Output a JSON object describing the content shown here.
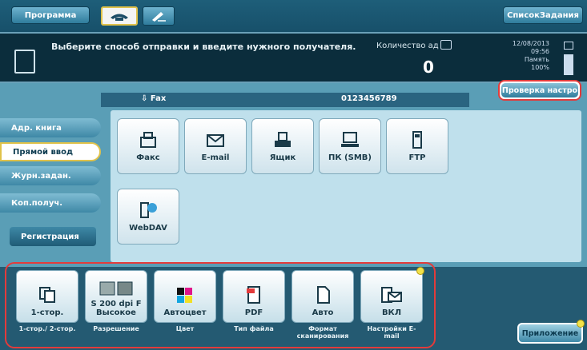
{
  "topbar": {
    "program_label": "Программа",
    "job_list_label": "СписокЗадания"
  },
  "message": {
    "text": "Выберите способ отправки и введите нужного получателя.",
    "count_label": "Количество ад",
    "count_value": "0",
    "date_lines": [
      "12/08/2013",
      "09:56",
      "Память",
      "100%"
    ]
  },
  "destination": {
    "type_label": "Fax",
    "number": "0123456789"
  },
  "check_settings_label": "Проверка настро",
  "left_nav": [
    {
      "label": "Адр. книга"
    },
    {
      "label": "Прямой ввод"
    },
    {
      "label": "Журн.задан."
    },
    {
      "label": "Коп.получ."
    },
    {
      "label": "Регистрация"
    }
  ],
  "dest_types": [
    {
      "label": "Факс",
      "icon": "fax-icon"
    },
    {
      "label": "E-mail",
      "icon": "email-icon"
    },
    {
      "label": "Ящик",
      "icon": "box-icon"
    },
    {
      "label": "ПК (SMB)",
      "icon": "pc-icon"
    },
    {
      "label": "FTP",
      "icon": "ftp-icon"
    },
    {
      "label": "WebDAV",
      "icon": "webdav-icon"
    }
  ],
  "settings": [
    {
      "value": "1-стор.",
      "caption": "1-стор./ 2-стор."
    },
    {
      "value": "S 200 dpi F Высокое",
      "caption": "Разрешение"
    },
    {
      "value": "Автоцвет",
      "caption": "Цвет"
    },
    {
      "value": "PDF",
      "caption": "Тип файла"
    },
    {
      "value": "Авто",
      "caption": "Формат сканирования"
    },
    {
      "value": "ВКЛ",
      "caption": "Настройки E-mail"
    }
  ],
  "apps_label": "Приложение",
  "colors": {
    "accent_red": "#e33b3b",
    "panel_blue": "#5a9eb6",
    "dark_bar": "#0b2d3c"
  }
}
